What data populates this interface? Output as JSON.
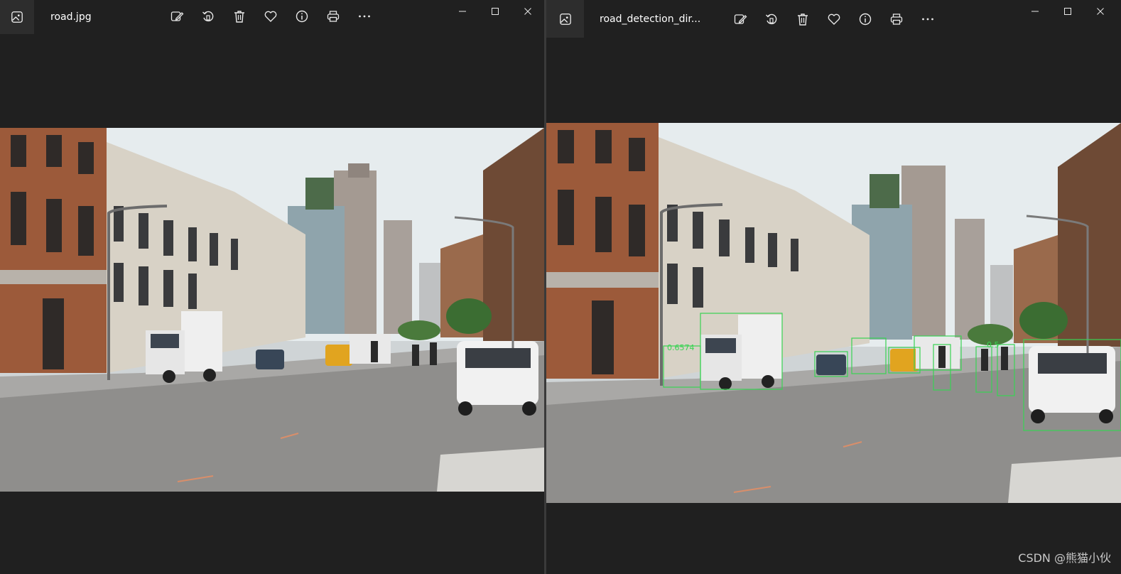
{
  "left_window": {
    "title": "road.jpg",
    "toolbar": [
      {
        "name": "edit-image-icon",
        "label": "Edit image"
      },
      {
        "name": "rotate-icon",
        "label": "Rotate"
      },
      {
        "name": "delete-icon",
        "label": "Delete"
      },
      {
        "name": "favorite-icon",
        "label": "Favorite"
      },
      {
        "name": "info-icon",
        "label": "File info"
      },
      {
        "name": "print-icon",
        "label": "Print"
      },
      {
        "name": "more-icon",
        "label": "See more"
      }
    ]
  },
  "right_window": {
    "title": "road_detection_dir...",
    "detection_labels": [
      "0.6574",
      "0.5"
    ]
  },
  "watermark": "CSDN @熊猫小伙",
  "colors": {
    "background": "#202020",
    "app_icon_bg": "#2d2d2d",
    "detection_box": "#39d353"
  }
}
